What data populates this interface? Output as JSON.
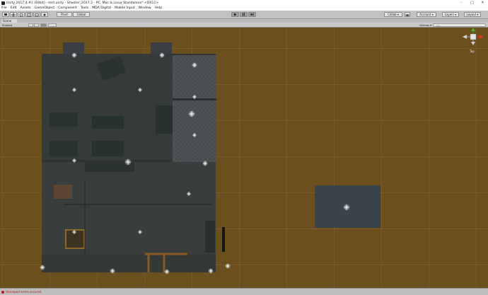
{
  "window": {
    "title": "Unity 2017.4.#1 (64bit) - test.unity - Shooter_2017.2 - PC, Mac & Linux Standalone* <DX11>",
    "controls": [
      "–",
      "□",
      "✕"
    ]
  },
  "menu": [
    "File",
    "Edit",
    "Assets",
    "GameObject",
    "Component",
    "Tools",
    "MDA Digital",
    "Mobile Input",
    "Window",
    "Help"
  ],
  "toolbar": {
    "pivot_label": "Pivot",
    "global_label": "Global",
    "play_icon": "play-icon",
    "pause_icon": "pause-icon",
    "step_icon": "step-icon",
    "collab_label": "Collab ▾",
    "account_label": "Account ▾",
    "layers_label": "Layers ▾",
    "layout_label": "Layout ▾"
  },
  "scene": {
    "tab_label": "Scene",
    "shading_mode": "Shaded",
    "gizmos_label": "Gizmos ▾",
    "search_placeholder": "All",
    "view_label": "Top"
  },
  "status": {
    "error_message": "Unscoped errors occured"
  },
  "colors": {
    "ground": "#6b4f1d",
    "floor": "#2e3332",
    "error": "#c0161a"
  }
}
